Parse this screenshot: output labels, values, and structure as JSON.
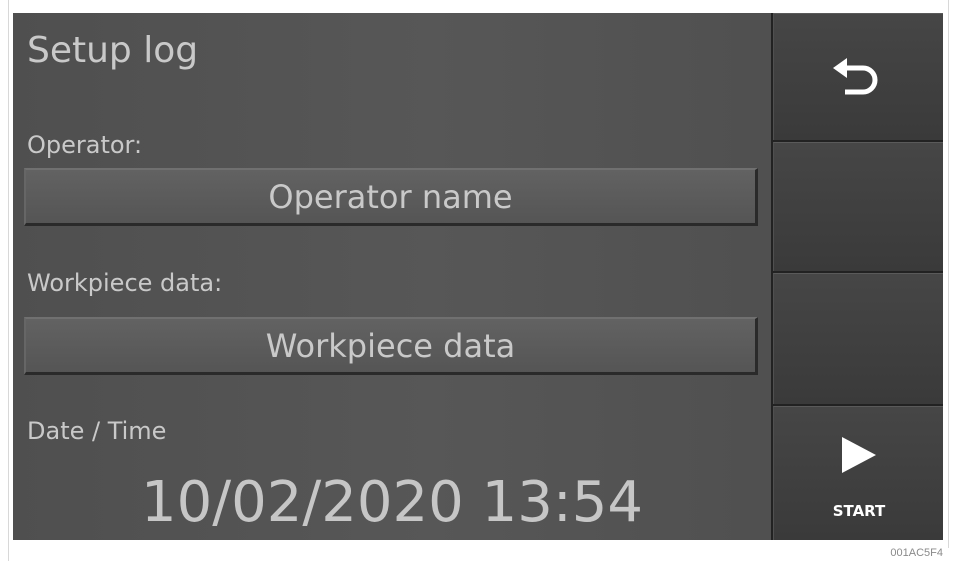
{
  "title": "Setup log",
  "operator": {
    "label": "Operator:",
    "value": "Operator name"
  },
  "workpiece": {
    "label": "Workpiece data:",
    "value": "Workpiece data"
  },
  "datetime": {
    "label": "Date / Time",
    "value": "10/02/2020 13:54"
  },
  "sidebar": {
    "back_icon": "return-arrow-icon",
    "start_icon": "play-triangle-icon",
    "start_label": "START"
  },
  "footer_code": "001AC5F4",
  "colors": {
    "background": "#545454",
    "text": "#c9c9c9",
    "sidebar": "#222222",
    "icon": "#ffffff"
  }
}
